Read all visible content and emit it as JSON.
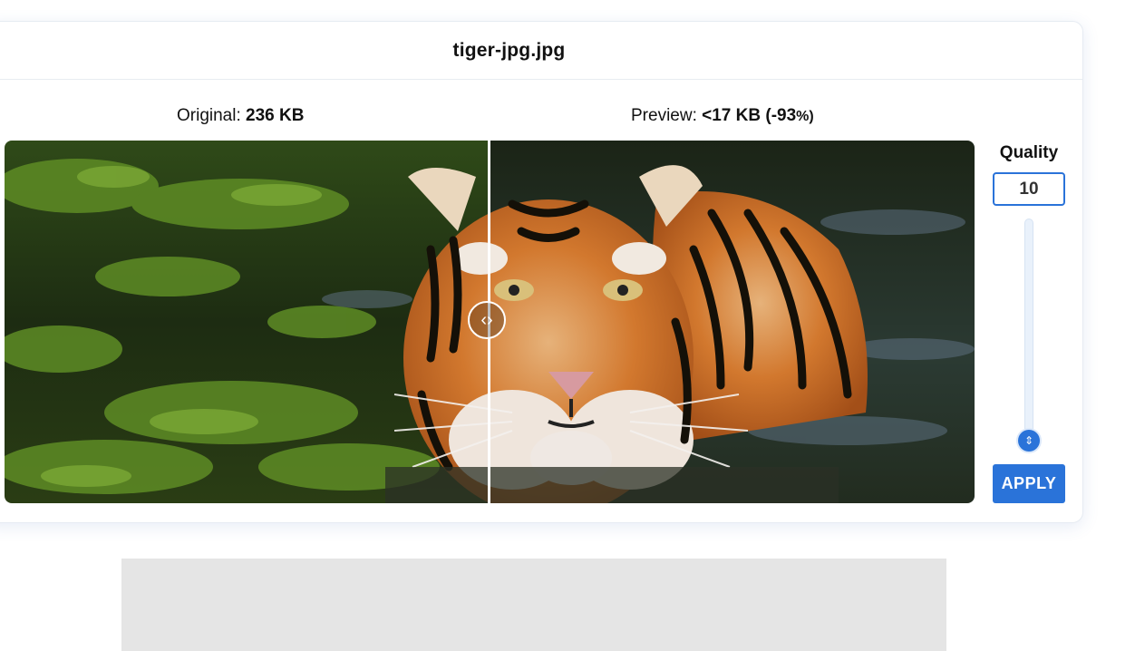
{
  "file": {
    "name": "tiger-jpg.jpg"
  },
  "compare": {
    "original_prefix": "Original: ",
    "original_size": "236 KB",
    "preview_prefix": "Preview: ",
    "preview_size": "<17 KB (-93",
    "preview_pct": "%)",
    "split_position": 0.5
  },
  "image": {
    "subject": "tiger swimming in green water"
  },
  "quality": {
    "title": "Quality",
    "value": "10",
    "slider_level": 0.1,
    "apply_label": "APPLY"
  },
  "icons": {
    "compare_handle": "left-right-chevrons-icon",
    "slider_thumb": "up-down-icon"
  },
  "colors": {
    "accent": "#2a73d9",
    "ad_background": "#e5e5e5"
  }
}
